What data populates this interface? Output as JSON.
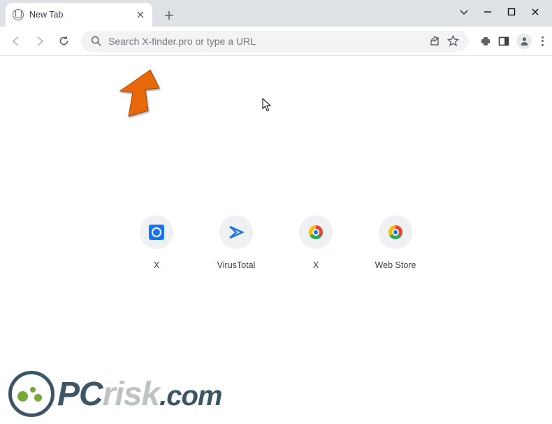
{
  "window": {
    "tab_title": "New Tab"
  },
  "omnibox": {
    "placeholder": "Search X-finder.pro or type a URL"
  },
  "shortcuts": [
    {
      "label": "X",
      "icon": "x"
    },
    {
      "label": "VirusTotal",
      "icon": "vt"
    },
    {
      "label": "X",
      "icon": "chrome"
    },
    {
      "label": "Web Store",
      "icon": "chrome"
    }
  ],
  "watermark": {
    "prefix": "PC",
    "mid": "risk",
    "suffix": ".com"
  }
}
